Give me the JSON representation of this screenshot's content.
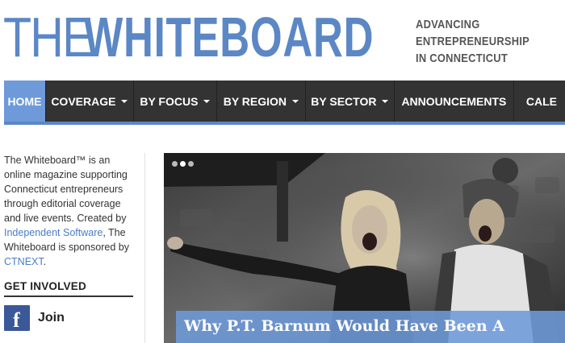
{
  "header": {
    "logo_the": "THE",
    "logo_whiteboard": "WHITEBOARD",
    "tagline": [
      "ADVANCING",
      "ENTREPRENEURSHIP",
      "IN CONNECTICUT"
    ]
  },
  "nav": {
    "items": [
      {
        "label": "HOME",
        "active": true,
        "dropdown": false
      },
      {
        "label": "COVERAGE",
        "active": false,
        "dropdown": true
      },
      {
        "label": "BY FOCUS",
        "active": false,
        "dropdown": true
      },
      {
        "label": "BY REGION",
        "active": false,
        "dropdown": true
      },
      {
        "label": "BY SECTOR",
        "active": false,
        "dropdown": true
      },
      {
        "label": "ANNOUNCEMENTS",
        "active": false,
        "dropdown": false
      },
      {
        "label": "CALE",
        "active": false,
        "dropdown": false
      }
    ]
  },
  "sidebar": {
    "about_intro": "The Whiteboard™ is an online magazine supporting Connecticut entrepreneurs through editorial coverage and live events. Created by ",
    "about_link1": "Independent Software",
    "about_mid": ", The Whiteboard is sponsored by ",
    "about_link2": "CTNEXT",
    "about_end": ".",
    "get_involved_heading": "GET INVOLVED",
    "join_label": "Join",
    "facebook_icon": "facebook-icon"
  },
  "hero": {
    "caption": "Why P.T. Barnum Would Have Been A",
    "slide_count": 3,
    "active_slide": 2
  },
  "colors": {
    "brand_blue": "#5b87c5",
    "nav_bg": "#333333",
    "nav_active": "#6e9ad9",
    "link": "#4a7cc7"
  }
}
